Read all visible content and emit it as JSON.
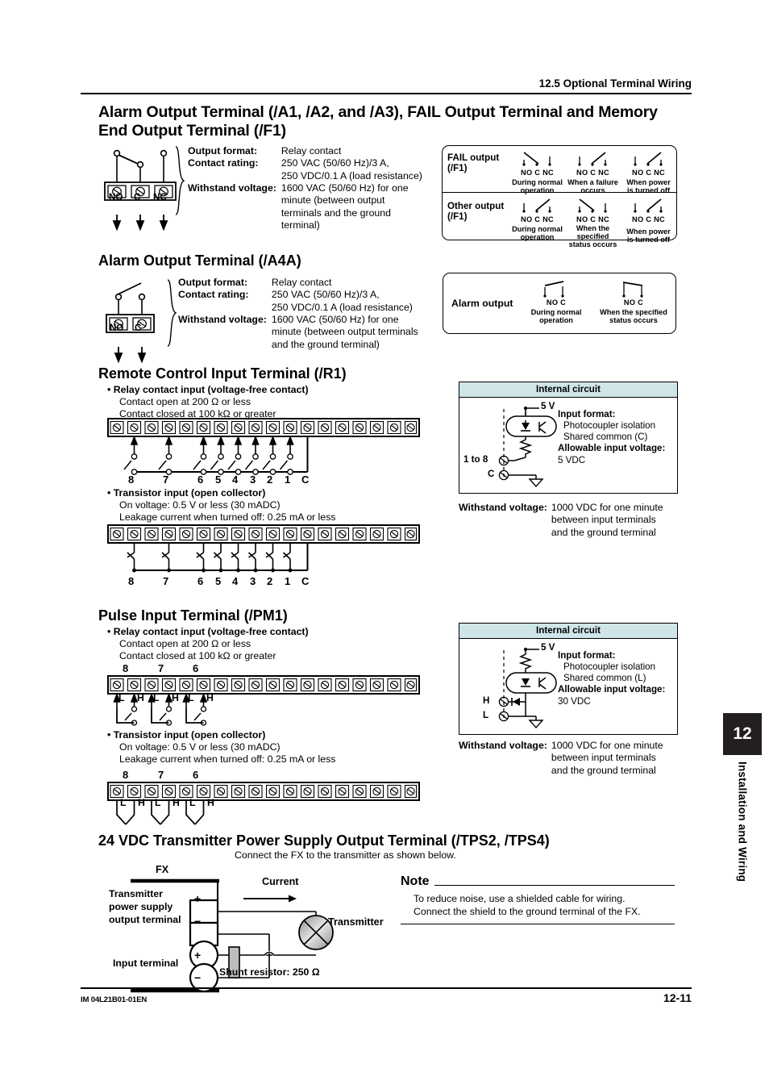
{
  "header": {
    "section": "12.5  Optional Terminal Wiring"
  },
  "footer": {
    "manual_id": "IM 04L21B01-01EN",
    "page": "12-11"
  },
  "side_tab": {
    "chapter": "12",
    "label": "Installation and Wiring"
  },
  "sections": {
    "alarm_a1": {
      "title": "Alarm Output Terminal (/A1, /A2, and /A3), FAIL Output Terminal and Memory End Output Terminal (/F1)",
      "terminal_labels": [
        "NO",
        "C",
        "NC"
      ],
      "specs": [
        {
          "label": "Output format:",
          "value": "Relay contact"
        },
        {
          "label": "Contact rating:",
          "value": "250 VAC (50/60 Hz)/3 A,\n250 VDC/0.1 A (load resistance)"
        },
        {
          "label": "Withstand voltage:",
          "value": "1600 VAC (50/60 Hz) for one minute (between output terminals and the ground terminal)"
        }
      ],
      "spec_lines": {
        "output_format": "Relay contact",
        "contact_rating_1": "250 VAC (50/60 Hz)/3 A,",
        "contact_rating_2": "250 VDC/0.1 A (load resistance)",
        "withstand_1": "1600 VAC (50/60 Hz) for one",
        "withstand_2": "minute (between output",
        "withstand_3": "terminals and the ground",
        "withstand_4": "terminal)"
      },
      "table": {
        "rows": [
          {
            "name": "FAIL output",
            "name2": "(/F1)",
            "states": [
              {
                "pins": "NO C NC",
                "caption": "During normal\noperation",
                "caption_l1": "During normal",
                "caption_l2": "operation",
                "caption_l3": "",
                "contact": "nc"
              },
              {
                "pins": "NO C NC",
                "caption": "When a failure\noccurs",
                "caption_l1": "When a failure",
                "caption_l2": "occurs",
                "caption_l3": "",
                "contact": "no"
              },
              {
                "pins": "NO C NC",
                "caption": "When power\nis turned off",
                "caption_l1": "When power",
                "caption_l2": "is turned off",
                "caption_l3": "",
                "contact": "no"
              }
            ]
          },
          {
            "name": "Other output",
            "name2": "(/F1)",
            "states": [
              {
                "pins": "NO C NC",
                "caption": "During normal\noperation",
                "caption_l1": "During normal",
                "caption_l2": "operation",
                "caption_l3": "",
                "contact": "no"
              },
              {
                "pins": "NO C NC",
                "caption": "When the\nspecified\nstatus occurs",
                "caption_l1": "When the",
                "caption_l2": "specified",
                "caption_l3": "status occurs",
                "contact": "nc"
              },
              {
                "pins": "NO C NC",
                "caption": "When power\nis turned off",
                "caption_l1": "When power",
                "caption_l2": "is turned off",
                "caption_l3": "",
                "contact": "no"
              }
            ]
          }
        ]
      }
    },
    "alarm_a4a": {
      "title": "Alarm Output Terminal (/A4A)",
      "terminal_labels": [
        "NO",
        "C"
      ],
      "spec_lines": {
        "output_format_label": "Output format:",
        "output_format": "Relay contact",
        "contact_rating_label": "Contact rating:",
        "contact_rating_1": "250 VAC (50/60 Hz)/3 A,",
        "contact_rating_2": "250 VDC/0.1 A (load resistance)",
        "withstand_label": "Withstand voltage:",
        "withstand_1": "1600 VAC (50/60 Hz) for one",
        "withstand_2": "minute (between output terminals",
        "withstand_3": "and the ground terminal)"
      },
      "box": {
        "row_name": "Alarm output",
        "states": [
          {
            "pins": "NO C",
            "caption_l1": "During normal",
            "caption_l2": "operation",
            "contact": "open"
          },
          {
            "pins": "NO C",
            "caption_l1": "When the specified",
            "caption_l2": "status occurs",
            "contact": "closed"
          }
        ]
      }
    },
    "remote_r1": {
      "title": "Remote Control Input Terminal (/R1)",
      "relay": {
        "bullet": "• Relay contact input (voltage-free contact)",
        "line1": "Contact open at 200 Ω or less",
        "line2": "Contact closed at 100 kΩ or greater",
        "pin_labels": [
          "8",
          "7",
          "6",
          "5",
          "4",
          "3",
          "2",
          "1",
          "C"
        ]
      },
      "transistor": {
        "bullet": "• Transistor input (open collector)",
        "line1": "On voltage: 0.5 V or less (30 mADC)",
        "line2": "Leakage current when turned off: 0.25 mA or less",
        "pin_labels": [
          "8",
          "7",
          "6",
          "5",
          "4",
          "3",
          "2",
          "1",
          "C"
        ]
      },
      "internal": {
        "header": "Internal circuit",
        "supply": "5 V",
        "left_label_1": "1 to 8",
        "left_label_2": "C",
        "input_format_label": "Input format:",
        "input_format_1": "Photocoupler isolation",
        "input_format_2": "Shared common (C)",
        "allowable_label": "Allowable input voltage:",
        "allowable_value": "5 VDC"
      },
      "withstand": {
        "label": "Withstand voltage:",
        "line1": "1000 VDC for one minute",
        "line2": "between input terminals",
        "line3": "and the ground terminal"
      }
    },
    "pulse_pm1": {
      "title": "Pulse Input Terminal (/PM1)",
      "relay": {
        "bullet": "• Relay contact input (voltage-free contact)",
        "line1": "Contact open at 200 Ω or less",
        "line2": "Contact closed at 100 kΩ or greater",
        "pin_numbers": [
          "8",
          "7",
          "6"
        ],
        "pin_pairs": [
          "L",
          "H",
          "L",
          "H",
          "L",
          "H"
        ]
      },
      "transistor": {
        "bullet": "• Transistor input (open collector)",
        "line1": "On voltage: 0.5 V or less (30 mADC)",
        "line2": "Leakage current when turned off: 0.25 mA or less",
        "pin_numbers": [
          "8",
          "7",
          "6"
        ],
        "pin_pairs": [
          "L",
          "H",
          "L",
          "H",
          "L",
          "H"
        ]
      },
      "internal": {
        "header": "Internal circuit",
        "supply": "5 V",
        "left_label_1": "H",
        "left_label_2": "L",
        "input_format_label": "Input format:",
        "input_format_1": "Photocoupler isolation",
        "input_format_2": "Shared common (L)",
        "allowable_label": "Allowable input voltage:",
        "allowable_value": "30 VDC"
      },
      "withstand": {
        "label": "Withstand voltage:",
        "line1": "1000 VDC for one minute",
        "line2": "between input terminals",
        "line3": "and the ground terminal"
      }
    },
    "tps": {
      "title": "24 VDC Transmitter Power Supply Output Terminal (/TPS2, /TPS4)",
      "subtitle": "Connect the FX to the transmitter as shown below.",
      "diagram": {
        "fx_label": "FX",
        "current_label": "Current",
        "transmitter_label": "Transmitter",
        "power_terminal_l1": "Transmitter",
        "power_terminal_l2": "power supply",
        "power_terminal_l3": "output terminal",
        "input_terminal": "Input terminal",
        "shunt_label": "Shunt resistor: 250 Ω",
        "plus": "+",
        "minus": "−"
      },
      "note": {
        "title": "Note",
        "line1": "To reduce noise, use a shielded cable for wiring.",
        "line2": "Connect the shield to the ground terminal of the FX."
      }
    }
  },
  "colors": {
    "internal_header_bg": "#cfe5e8",
    "tab_bg": "#231f20",
    "ink": "#000000"
  }
}
